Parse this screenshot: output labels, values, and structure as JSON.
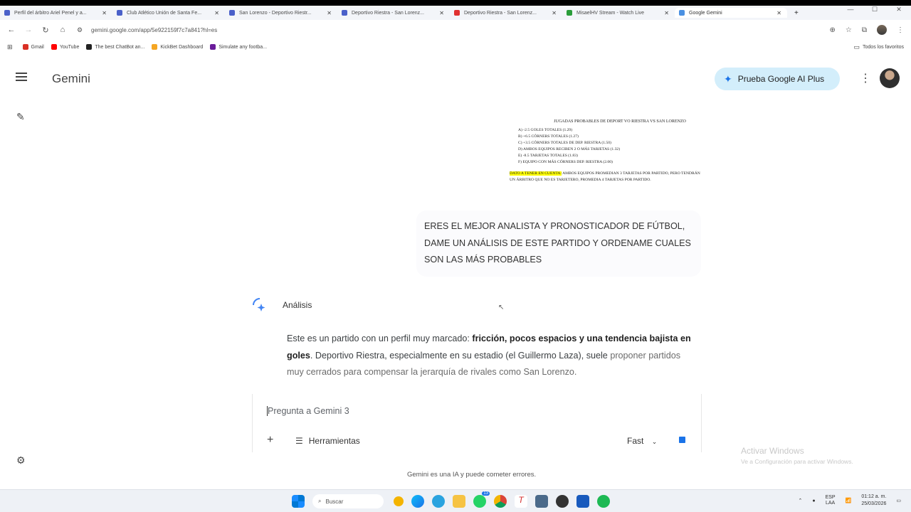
{
  "browser": {
    "tabs": [
      {
        "title": "Perfil del árbitro Ariel Penel y a...",
        "color": "#4a60c9"
      },
      {
        "title": "Club Atlético Unión de Santa Fe...",
        "color": "#4a60c9"
      },
      {
        "title": "San Lorenzo - Deportivo Riestr...",
        "color": "#4a60c9"
      },
      {
        "title": "Deportivo Riestra - San Lorenz...",
        "color": "#4a60c9"
      },
      {
        "title": "Deportivo Riestra - San Lorenz...",
        "color": "#e03131"
      },
      {
        "title": "MisaelHV Stream - Watch Live",
        "color": "#2a9d3a"
      },
      {
        "title": "Google Gemini",
        "color": "#4a90e2"
      }
    ],
    "url": "gemini.google.com/app/5e922159f7c7a841?hl=es",
    "bookmarks": [
      {
        "label": "Gmail",
        "color": "#d93025"
      },
      {
        "label": "YouTube",
        "color": "#ff0000"
      },
      {
        "label": "The best ChatBot an...",
        "color": "#222222"
      },
      {
        "label": "KickBet Dashboard",
        "color": "#f5a623"
      },
      {
        "label": "Simulate any footba...",
        "color": "#6a1b9a"
      }
    ],
    "all_bookmarks": "Todos los favoritos"
  },
  "header": {
    "title": "Gemini",
    "upgrade_label": "Prueba Google AI Plus"
  },
  "attachment": {
    "title": "JUGADAS PROBABLES DE DEPORT VO RIESTRA VS SAN LORENZO",
    "lines": [
      "A)   -2.5 GOLES TOTALES (1.29)",
      "B)   +6.5 CÓRNERS TOTALES (1.27)",
      "C)   +3.5 CÓRNERS TOTALES DE DEP. RIESTRA (1.50)",
      "D)   AMBOS EQUIPOS RECIBEN 2 O MÁS TARJETAS (1.32)",
      "E)   -8.5 TARJETAS TOTALES (1.83)",
      "F)   EQUIPO CON MÁS CÓRNERS DEP. RIESTRA (2.00)"
    ],
    "note_highlight": "DATO A TENER EN CUENTA:",
    "note_rest": " AMBOS EQUIPOS PROMEDIAN 3 TARJETAS POR PARTIDO, PERO TENDRÁN UN ÁRBITRO QUE NO ES TARJETERO, PROMEDIA 4 TARJETAS POR PARTIDO."
  },
  "user_message": "ERES EL MEJOR ANALISTA Y PRONOSTICADOR DE FÚTBOL, DAME UN ANÁLISIS DE ESTE PARTIDO Y ORDENAME CUALES SON LAS MÁS PROBABLES",
  "response": {
    "label": "Análisis",
    "intro": "Este es un partido con un perfil muy marcado: ",
    "bold": "fricción, pocos espacios y una tendencia bajista en goles",
    "text1": ". Deportivo Riestra, especialmente en su estadio (el Guillermo Laza), suele ",
    "text2": "proponer partidos muy cerrados para compensar la jerarquía de rivales como San Lorenzo."
  },
  "input": {
    "placeholder": "Pregunta a Gemini 3",
    "tools_label": "Herramientas",
    "mode_label": "Fast"
  },
  "disclaimer": "Gemini es una IA y puede cometer errores.",
  "watermark": {
    "line1": "Activar Windows",
    "line2": "Ve a Configuración para activar Windows."
  },
  "taskbar": {
    "search_label": "Buscar",
    "lang": "ESP\nLAA",
    "time": "01:12 a. m.",
    "date": "25/03/2026",
    "whatsapp_badge": "13"
  }
}
